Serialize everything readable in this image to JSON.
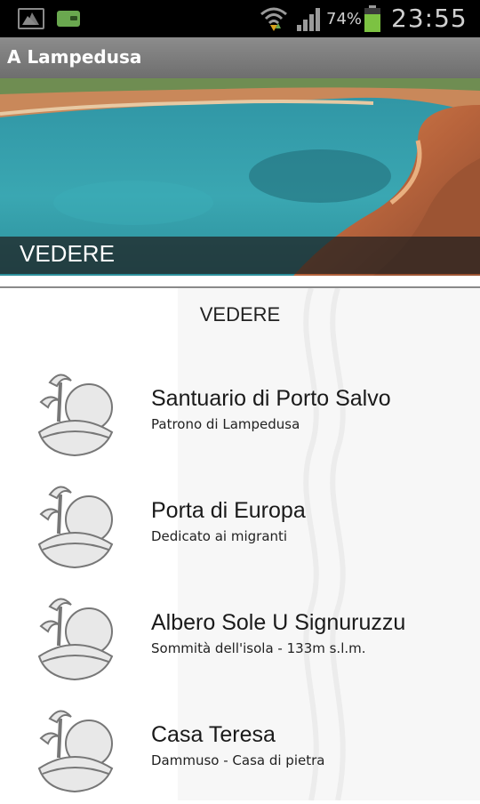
{
  "status_bar": {
    "battery_percent": "74%",
    "time": "23:55",
    "icons": [
      "gallery-icon",
      "wallet-icon",
      "wifi-icon",
      "signal-icon",
      "battery-icon"
    ]
  },
  "action_bar": {
    "title": "A Lampedusa"
  },
  "banner": {
    "caption": "VEDERE"
  },
  "section": {
    "heading": "VEDERE"
  },
  "items": [
    {
      "title": "Santuario di Porto Salvo",
      "subtitle": "Patrono di Lampedusa",
      "icon": "island-icon"
    },
    {
      "title": "Porta di Europa",
      "subtitle": "Dedicato ai migranti",
      "icon": "island-icon"
    },
    {
      "title": "Albero Sole U Signuruzzu",
      "subtitle": "Sommità dell'isola - 133m s.l.m.",
      "icon": "island-icon"
    },
    {
      "title": "Casa Teresa",
      "subtitle": "Dammuso - Casa di pietra",
      "icon": "island-icon"
    }
  ],
  "colors": {
    "status_bar": "#000000",
    "action_bar": "#7d7d7d",
    "sea": "#3fa6b0",
    "rock": "#c0704a"
  }
}
